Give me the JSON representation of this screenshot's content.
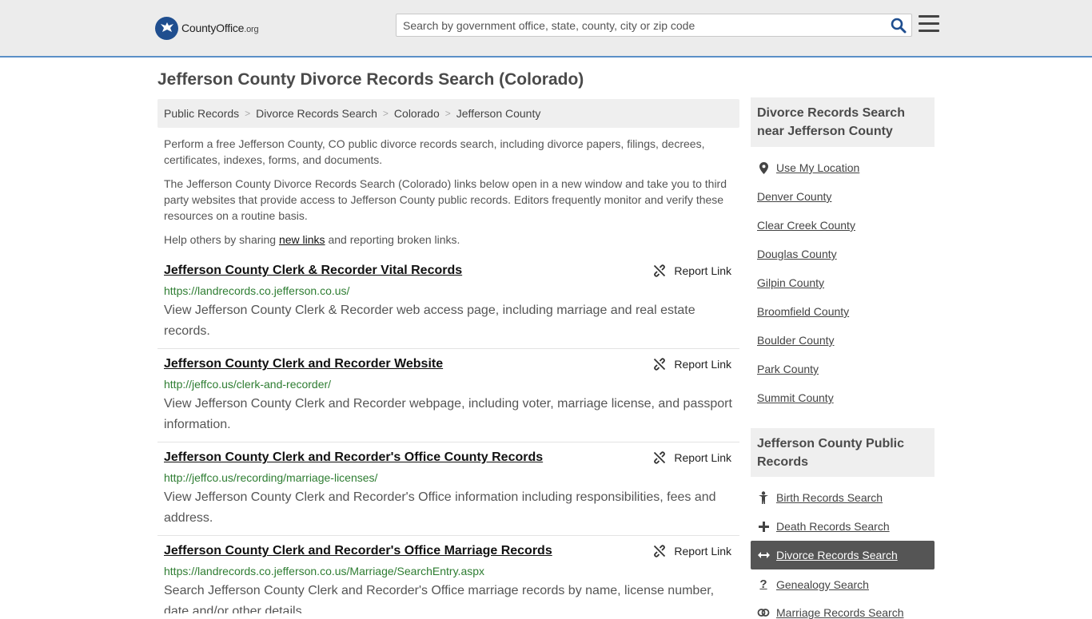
{
  "header": {
    "logo_brand": "CountyOffice",
    "logo_suffix": ".org",
    "search_placeholder": "Search by government office, state, county, city or zip code"
  },
  "page_title": "Jefferson County Divorce Records Search (Colorado)",
  "breadcrumb": [
    "Public Records",
    "Divorce Records Search",
    "Colorado",
    "Jefferson County"
  ],
  "intro": {
    "p1": "Perform a free Jefferson County, CO public divorce records search, including divorce papers, filings, decrees, certificates, indexes, forms, and documents.",
    "p2": "The Jefferson County Divorce Records Search (Colorado) links below open in a new window and take you to third party websites that provide access to Jefferson County public records. Editors frequently monitor and verify these resources on a routine basis.",
    "p3_before": "Help others by sharing ",
    "p3_link": "new links",
    "p3_after": " and reporting broken links."
  },
  "report_label": "Report Link",
  "results": [
    {
      "title": "Jefferson County Clerk & Recorder Vital Records",
      "url": "https://landrecords.co.jefferson.co.us/",
      "description": "View Jefferson County Clerk & Recorder web access page, including marriage and real estate records."
    },
    {
      "title": "Jefferson County Clerk and Recorder Website",
      "url": "http://jeffco.us/clerk-and-recorder/",
      "description": "View Jefferson County Clerk and Recorder webpage, including voter, marriage license, and passport information."
    },
    {
      "title": "Jefferson County Clerk and Recorder's Office County Records",
      "url": "http://jeffco.us/recording/marriage-licenses/",
      "description": "View Jefferson County Clerk and Recorder's Office information including responsibilities, fees and address."
    },
    {
      "title": "Jefferson County Clerk and Recorder's Office Marriage Records",
      "url": "https://landrecords.co.jefferson.co.us/Marriage/SearchEntry.aspx",
      "description": "Search Jefferson County Clerk and Recorder's Office marriage records by name, license number, date and/or other details."
    }
  ],
  "sidebar": {
    "nearby_heading": "Divorce Records Search near Jefferson County",
    "use_location": "Use My Location",
    "nearby": [
      "Denver County",
      "Clear Creek County",
      "Douglas County",
      "Gilpin County",
      "Broomfield County",
      "Boulder County",
      "Park County",
      "Summit County"
    ],
    "public_heading": "Jefferson County Public Records",
    "public_records": [
      {
        "label": "Birth Records Search",
        "icon": "person-icon"
      },
      {
        "label": "Death Records Search",
        "icon": "plus-icon"
      },
      {
        "label": "Divorce Records Search",
        "icon": "double-arrow-icon",
        "active": true
      },
      {
        "label": "Genealogy Search",
        "icon": "question-icon"
      },
      {
        "label": "Marriage Records Search",
        "icon": "rings-icon"
      }
    ]
  },
  "colors": {
    "brand_blue": "#1f4e8f",
    "url_green": "#2e7d32",
    "active_bg": "#555555",
    "header_border": "#5b8fc7"
  }
}
